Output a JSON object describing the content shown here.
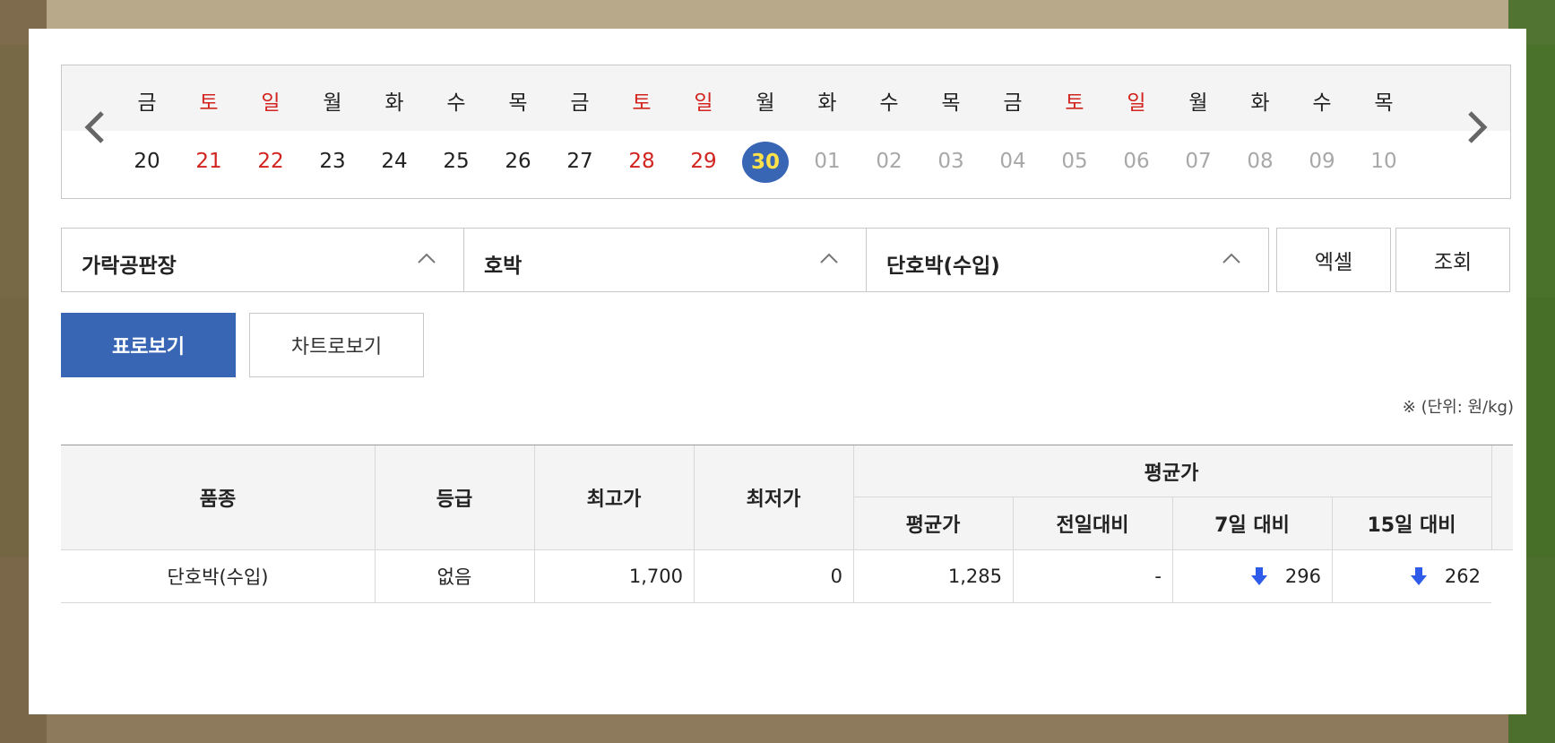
{
  "calendar": {
    "days": [
      "금",
      "토",
      "일",
      "월",
      "화",
      "수",
      "목",
      "금",
      "토",
      "일",
      "월",
      "화",
      "수",
      "목",
      "금",
      "토",
      "일",
      "월",
      "화",
      "수",
      "목"
    ],
    "dates": [
      "20",
      "21",
      "22",
      "23",
      "24",
      "25",
      "26",
      "27",
      "28",
      "29",
      "30",
      "01",
      "02",
      "03",
      "04",
      "05",
      "06",
      "07",
      "08",
      "09",
      "10"
    ],
    "weekend_indexes": [
      1,
      2,
      8,
      9,
      15,
      16
    ],
    "selected_index": 10,
    "future_start_index": 11
  },
  "filters": {
    "market": "가락공판장",
    "item": "호박",
    "variety": "단호박(수입)"
  },
  "buttons": {
    "excel": "엑셀",
    "search": "조회"
  },
  "tabs": {
    "table_view": "표로보기",
    "chart_view": "차트로보기"
  },
  "unit_note": "※ (단위: 원/kg)",
  "table": {
    "headers": {
      "variety": "품종",
      "grade": "등급",
      "max_price": "최고가",
      "min_price": "최저가",
      "avg_group": "평균가",
      "avg": "평균가",
      "prev_day": "전일대비",
      "vs_7day": "7일 대비",
      "vs_15day": "15일 대비"
    },
    "rows": [
      {
        "variety": "단호박(수입)",
        "grade": "없음",
        "max_price": "1,700",
        "min_price": "0",
        "avg": "1,285",
        "prev_day": "-",
        "vs_7day": "296",
        "vs_15day": "262",
        "trend_7day": "down",
        "trend_15day": "down"
      }
    ]
  },
  "colors": {
    "accent": "#3866b5",
    "weekend": "#d2231e",
    "selected_text": "#ffe14a",
    "down_arrow": "#2f5bea"
  }
}
